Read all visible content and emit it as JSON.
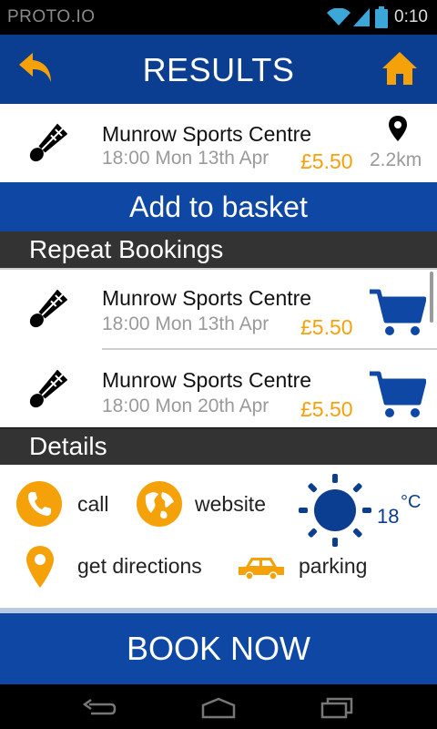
{
  "status_bar": {
    "app_name": "PROTO.IO",
    "time": "0:10"
  },
  "header": {
    "title": "RESULTS",
    "back_icon": "back-arrow-icon",
    "home_icon": "home-icon"
  },
  "result": {
    "venue": "Munrow Sports Centre",
    "datetime": "18:00 Mon 13th Apr",
    "price": "£5.50",
    "distance": "2.2km"
  },
  "add_to_basket_label": "Add to basket",
  "repeat_bookings": {
    "title": "Repeat Bookings",
    "items": [
      {
        "venue": "Munrow Sports Centre",
        "datetime": "18:00 Mon 13th Apr",
        "price": "£5.50"
      },
      {
        "venue": "Munrow Sports Centre",
        "datetime": "18:00 Mon 20th Apr",
        "price": "£5.50"
      }
    ]
  },
  "details": {
    "title": "Details",
    "call_label": "call",
    "website_label": "website",
    "directions_label": "get directions",
    "parking_label": "parking",
    "temperature": "18",
    "temperature_unit": "°C"
  },
  "book_now_label": "BOOK NOW",
  "colors": {
    "header": "#0b3d91",
    "button": "#0f47a4",
    "accent": "#f5a10a",
    "section": "#333333"
  }
}
